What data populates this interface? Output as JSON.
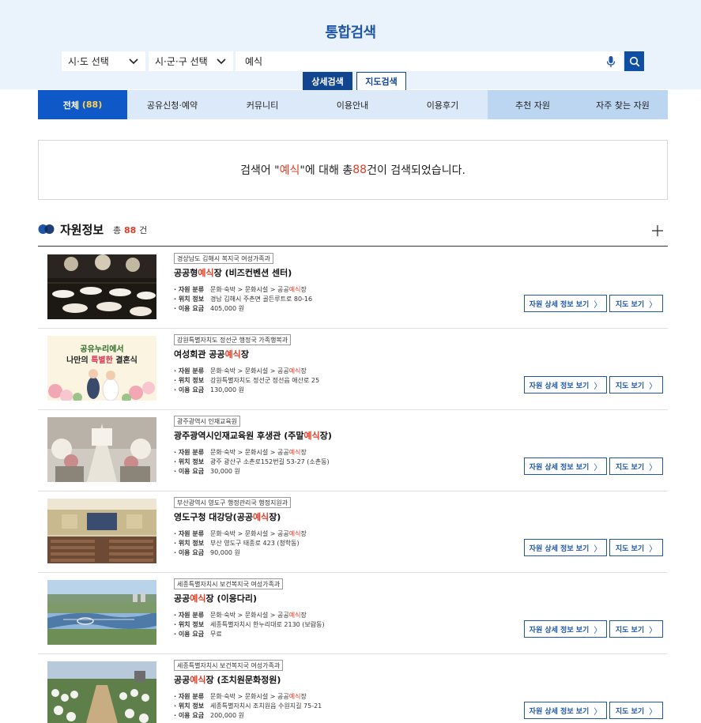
{
  "header": {
    "title": "통합검색",
    "region_select": "시·도 선택",
    "district_select": "시·군·구 선택",
    "search_value": "예식",
    "detail_tab": "상세검색",
    "map_tab": "지도검색"
  },
  "nav": {
    "tabs": [
      {
        "label": "전체",
        "count": "(88)"
      },
      {
        "label": "공유신청·예약"
      },
      {
        "label": "커뮤니티"
      },
      {
        "label": "이용안내"
      },
      {
        "label": "이용후기"
      },
      {
        "label": "추천 자원"
      },
      {
        "label": "자주 찾는 자원"
      }
    ]
  },
  "summary": {
    "prefix": "검색어 \"",
    "keyword": " 예식 ",
    "middle": "\"에 대해 총",
    "count": " 88 ",
    "suffix": "건이 검색되었습니다."
  },
  "section": {
    "title": "자원정보",
    "count_prefix": "총",
    "count": " 88 ",
    "count_suffix": "건"
  },
  "labels": {
    "category": "· 자원 분류",
    "location": "· 위치 정보",
    "fee": "· 이용 요금",
    "detail_button": "자원 상세 정보 보기",
    "map_button": "지도 보기",
    "arrow": "〉"
  },
  "items": [
    {
      "org": "경상남도 김해시 복지국 여성가족과",
      "name_pre": "공공형",
      "name_hl": "예식",
      "name_post": "장 (비즈컨벤션 센터)",
      "cat_pre": "문화·숙박 > 문화시설 > 공공",
      "cat_hl": "예식",
      "cat_post": "장",
      "location": "경남 김해시 주촌면 골든루트로 80-16",
      "fee": "405,000 원"
    },
    {
      "org": "강원특별자치도 정선군 행정국 가족행복과",
      "name_pre": "여성회관 공공",
      "name_hl": "예식",
      "name_post": "장",
      "cat_pre": "문화·숙박 > 문화시설 > 공공",
      "cat_hl": "예식",
      "cat_post": "장",
      "location": "강원특별자치도 정선군 정선읍 애산로 25",
      "fee": "130,000 원",
      "thumb_text_1": "공유누리에서",
      "thumb_text_2a": "나만의 ",
      "thumb_text_2b": "특별한",
      "thumb_text_2c": " 결혼식"
    },
    {
      "org": "광주광역시 인재교육원",
      "name_pre": "광주광역시인재교육원 후생관 (주말",
      "name_hl": "예식",
      "name_post": "장)",
      "cat_pre": "문화·숙박 > 문화시설 > 공공",
      "cat_hl": "예식",
      "cat_post": "장",
      "location": "광주 광산구 소촌로152번길 53-27 (소촌동)",
      "fee": "30,000 원"
    },
    {
      "org": "부산광역시 영도구 행정관리국 행정지원과",
      "name_pre": "영도구청 대강당(공공",
      "name_hl": "예식",
      "name_post": "장)",
      "cat_pre": "문화·숙박 > 문화시설 > 공공",
      "cat_hl": "예식",
      "cat_post": "장",
      "location": "부산 영도구 태종로 423 (청학동)",
      "fee": "90,000 원"
    },
    {
      "org": "세종특별자치시 보건복지국 여성가족과",
      "name_pre": "공공",
      "name_hl": "예식",
      "name_post": "장 (이응다리)",
      "cat_pre": "문화·숙박 > 문화시설 > 공공",
      "cat_hl": "예식",
      "cat_post": "장",
      "location": "세종특별자치시 한누리대로 2130 (보람동)",
      "fee": "무료"
    },
    {
      "org": "세종특별자치시 보건복지국 여성가족과",
      "name_pre": "공공",
      "name_hl": "예식",
      "name_post": "장 (조치원문화정원)",
      "cat_pre": "문화·숙박 > 문화시설 > 공공",
      "cat_hl": "예식",
      "cat_post": "장",
      "location": "세종특별자치시 조치원읍 수원지길 75-21",
      "fee": "200,000 원"
    }
  ],
  "colors": {
    "accent": "#0e58c8",
    "navy": "#12458f",
    "highlight": "#e03b24",
    "tab_bg": "#dce9f8",
    "top_bg": "#eaf2fb"
  }
}
